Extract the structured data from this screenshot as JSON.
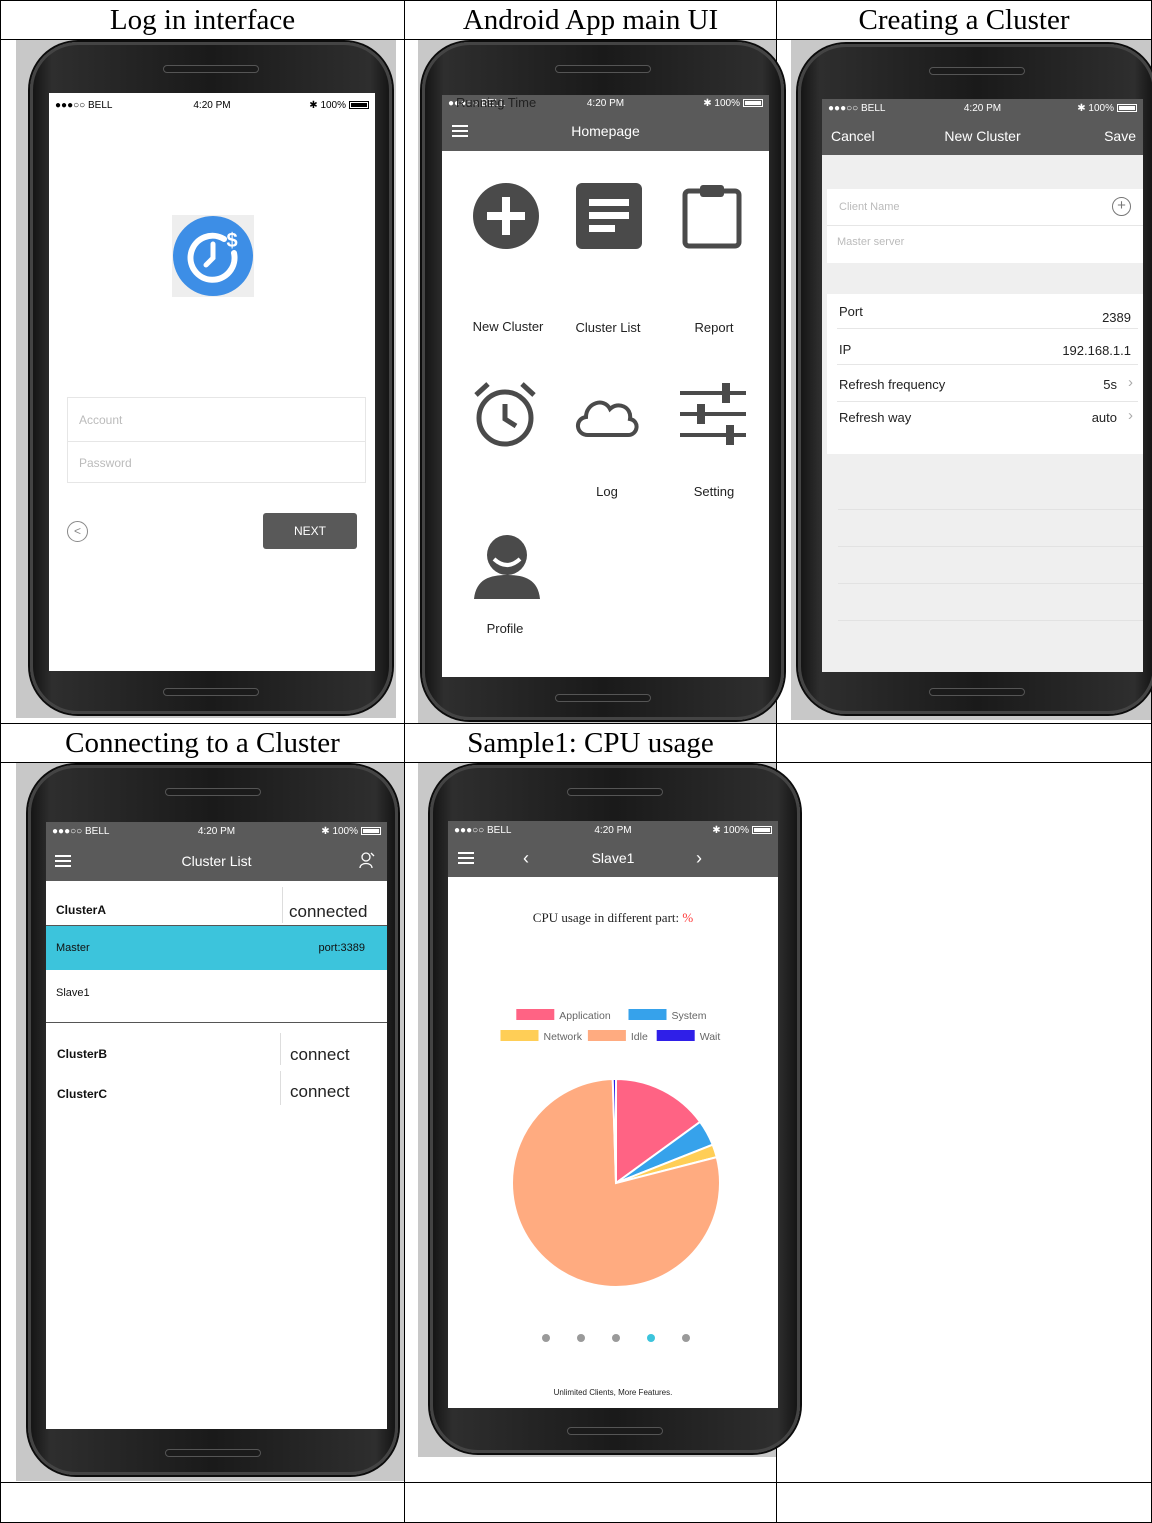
{
  "captions": {
    "login": "Log in interface",
    "main_ui": "Android App main UI",
    "create_cluster": "Creating a Cluster",
    "connect_cluster": "Connecting to a Cluster",
    "cpu_usage": "Sample1: CPU usage"
  },
  "status_bar": {
    "carrier": "●●●○○ BELL",
    "time": "4:20 PM",
    "battery": "100%"
  },
  "login": {
    "logo_color": "#3d8ee6",
    "account_placeholder": "Account",
    "password_placeholder": "Password",
    "next_label": "NEXT"
  },
  "homepage": {
    "title": "Homepage",
    "items": [
      {
        "label": "New Cluster",
        "icon": "plus-circle-icon"
      },
      {
        "label": "Cluster List",
        "icon": "document-list-icon"
      },
      {
        "label": "Report",
        "icon": "clipboard-icon"
      },
      {
        "label": "Running Time",
        "icon": "alarm-clock-icon"
      },
      {
        "label": "Log",
        "icon": "cloud-icon"
      },
      {
        "label": "Setting",
        "icon": "sliders-icon"
      },
      {
        "label": "Profile",
        "icon": "user-icon"
      }
    ]
  },
  "new_cluster": {
    "cancel": "Cancel",
    "title": "New Cluster",
    "save": "Save",
    "client_name_placeholder": "Client Name",
    "master_server_placeholder": "Master server",
    "rows": [
      {
        "label": "Port",
        "value": "2389"
      },
      {
        "label": "IP",
        "value": "192.168.1.1"
      },
      {
        "label": "Refresh frequency",
        "value": "5s"
      },
      {
        "label": "Refresh way",
        "value": "auto"
      }
    ]
  },
  "cluster_list": {
    "title": "Cluster List",
    "clusters": [
      {
        "name": "ClusterA",
        "status": "connected"
      },
      {
        "name": "ClusterB",
        "status": "connect"
      },
      {
        "name": "ClusterC",
        "status": "connect"
      }
    ],
    "master_label": "Master",
    "master_port": "port:3389",
    "slave_label": "Slave1",
    "highlight_color": "#3cc4dc"
  },
  "cpu": {
    "title": "Slave1",
    "chart_title": "CPU usage in different part: ",
    "chart_unit": "%",
    "footer": "Unlimited Clients, More Features.",
    "page_count": 5,
    "active_page": 4
  },
  "chart_data": {
    "type": "pie",
    "title": "CPU usage in different part: %",
    "legend_position": "top",
    "categories": [
      "Application",
      "System",
      "Network",
      "Idle",
      "Wait"
    ],
    "values": [
      15,
      4,
      2,
      78.5,
      0.5
    ],
    "colors": [
      "#ff6384",
      "#36a2eb",
      "#ffce56",
      "#ffab80",
      "#2f1fe8"
    ]
  }
}
